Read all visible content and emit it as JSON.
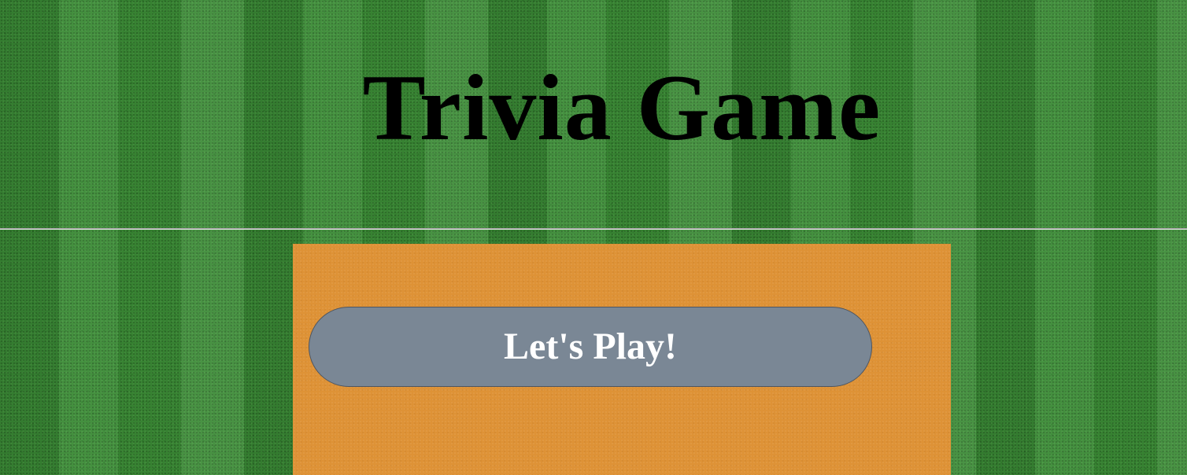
{
  "header": {
    "title": "Trivia Game"
  },
  "game": {
    "start_button_label": "Let's Play!"
  },
  "colors": {
    "background": "#3a8a35",
    "panel": "#de9236",
    "button": "#7a8795",
    "button_text": "#ffffff",
    "title_text": "#000000"
  }
}
